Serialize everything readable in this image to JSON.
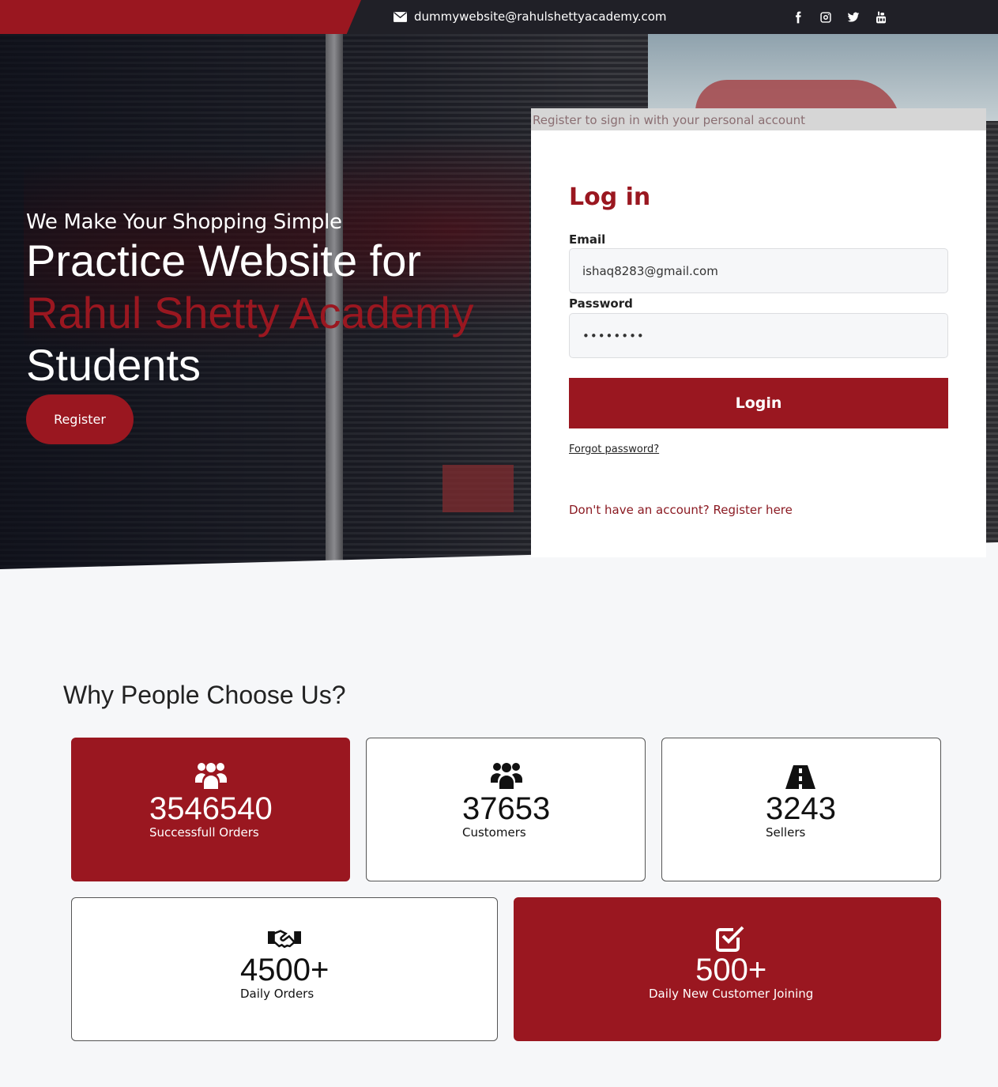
{
  "topbar": {
    "email": "dummywebsite@rahulshettyacademy.com",
    "icons": [
      "mail-icon",
      "facebook-icon",
      "instagram-icon",
      "twitter-icon",
      "youtube-icon"
    ]
  },
  "hero": {
    "subtitle": "We Make Your Shopping Simple",
    "title_line1": "Practice Website for",
    "title_line2": "Rahul Shetty Academy",
    "title_line3": "Students",
    "register_label": "Register"
  },
  "login": {
    "banner": "Register to sign in with your personal account",
    "title": "Log in",
    "email_label": "Email",
    "email_value": "ishaq8283@gmail.com",
    "password_label": "Password",
    "password_value": "••••••••",
    "login_label": "Login",
    "forgot_label": "Forgot password?",
    "register_prompt": "Don't have an account? Register here"
  },
  "why": {
    "title": "Why People Choose Us?",
    "stats": [
      {
        "icon": "users-icon",
        "value": "3546540",
        "label": "Successfull Orders"
      },
      {
        "icon": "users-icon",
        "value": "37653",
        "label": "Customers"
      },
      {
        "icon": "road-icon",
        "value": "3243",
        "label": "Sellers"
      },
      {
        "icon": "handshake-icon",
        "value": "4500+",
        "label": "Daily Orders"
      },
      {
        "icon": "check-square-icon",
        "value": "500+",
        "label": "Daily New Customer Joining"
      }
    ]
  },
  "colors": {
    "brand_red": "#9a1720",
    "topbar_dark": "#202027",
    "page_bg": "#f6f7f9"
  }
}
